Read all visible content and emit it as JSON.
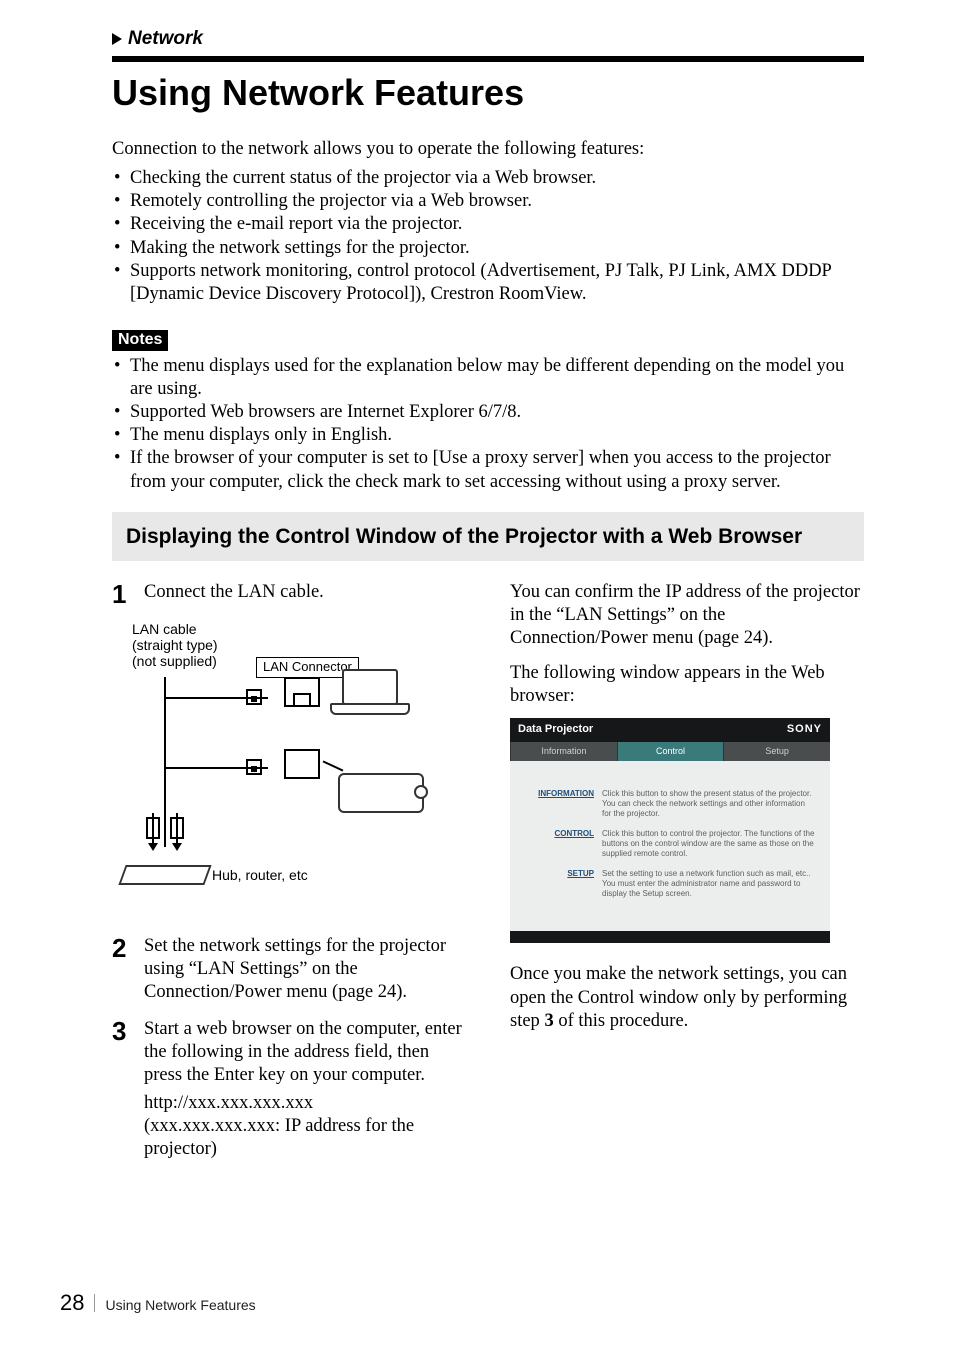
{
  "breadcrumb_label": "Network",
  "title": "Using Network Features",
  "intro": "Connection to the network allows you to operate the following features:",
  "feature_bullets": [
    "Checking the current status of the projector via a Web browser.",
    "Remotely controlling the projector via a Web browser.",
    "Receiving the e-mail report via the projector.",
    "Making the network settings for the projector.",
    "Supports network monitoring, control protocol (Advertisement, PJ Talk, PJ Link, AMX DDDP [Dynamic Device Discovery Protocol]), Crestron RoomView."
  ],
  "notes_label": "Notes",
  "notes_bullets": [
    "The menu displays used for the explanation below may be different depending on the model you are using.",
    "Supported Web browsers are Internet Explorer 6/7/8.",
    "The menu displays only in English.",
    "If the browser of your computer is set to [Use a proxy server] when you access to the projector from your computer, click the check mark to set accessing without using a proxy server."
  ],
  "subheading": "Displaying the Control Window of the Projector with a Web Browser",
  "steps": {
    "s1": {
      "num": "1",
      "text": "Connect the LAN cable."
    },
    "s2": {
      "num": "2",
      "text": "Set the network settings for the projector using “LAN Settings” on the Connection/Power menu (page 24)."
    },
    "s3": {
      "num": "3",
      "text": "Start a web browser on the computer, enter the following in the address field, then press the Enter key on your computer.",
      "url": "http://xxx.xxx.xxx.xxx",
      "url_note": "(xxx.xxx.xxx.xxx: IP address for the projector)"
    }
  },
  "diagram": {
    "lan_cable": "LAN cable\n(straight type)\n(not supplied)",
    "lan_connector": "LAN Connector",
    "hub_label": "Hub, router, etc"
  },
  "right": {
    "p1": "You can confirm the IP address of the projector in the “LAN Settings” on the Connection/Power menu (page 24).",
    "p2": "The following window appears in the Web browser:",
    "p3_a": "Once you make the network settings, you can open the Control window only by performing step ",
    "p3_bold": "3",
    "p3_b": " of this procedure."
  },
  "browser": {
    "title": "Data Projector",
    "brand": "SONY",
    "tabs": {
      "info": "Information",
      "control": "Control",
      "setup": "Setup"
    },
    "rows": {
      "r1": {
        "key": "INFORMATION",
        "desc": "Click this button to show the present status of the projector. You can check the network settings and other information for the projector."
      },
      "r2": {
        "key": "CONTROL",
        "desc": "Click this button to control the projector. The functions of the buttons on the control window are the same as those on the supplied remote control."
      },
      "r3": {
        "key": "SETUP",
        "desc": "Set the setting to use a network function such as mail, etc.. You must enter the administrator name and password to display the Setup screen."
      }
    }
  },
  "footer": {
    "page": "28",
    "title": "Using Network Features"
  }
}
